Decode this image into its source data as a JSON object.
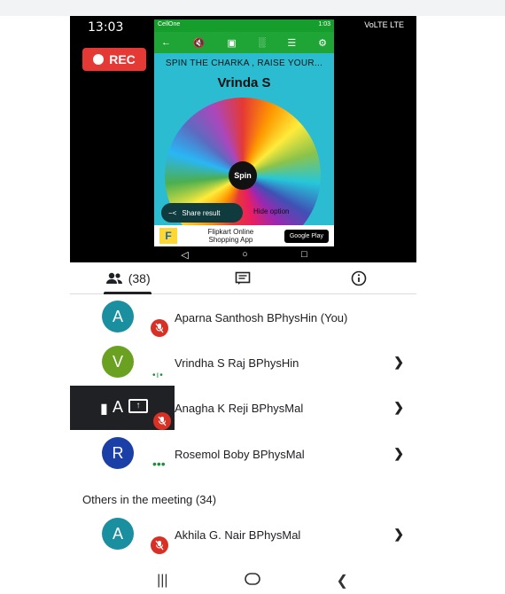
{
  "video": {
    "status_time": "13:03",
    "status_right": "VoLTE LTE",
    "rec_label": "REC",
    "phone": {
      "carrier": "CellOne",
      "clock": "1:03",
      "title": "SPIN THE CHARKA , RAISE YOUR...",
      "winner": "Vrinda S",
      "spin_label": "Spin",
      "share_label": "Share result",
      "hide_label": "Hide option",
      "ad_line1": "Flipkart Online",
      "ad_line2": "Shopping App",
      "ad_store": "Google Play",
      "ad_logo": "F"
    }
  },
  "tabs": {
    "people_count": "(38)"
  },
  "participants": [
    {
      "initial": "A",
      "name": "Aparna Santhosh BPhysHin (You)",
      "color": "#1a8fa0",
      "status": "muted"
    },
    {
      "initial": "V",
      "name": "Vrindha S Raj BPhysHin",
      "color": "#6aa121",
      "status": "speaking"
    },
    {
      "initial": "A",
      "name": "Anagha K Reji BPhysMal",
      "color": "#202124",
      "status": "muted-presenting"
    },
    {
      "initial": "R",
      "name": "Rosemol Boby BPhysMal",
      "color": "#1a3fa6",
      "status": "more"
    },
    {
      "initial": "A",
      "name": "Akhila G. Nair BPhysMal",
      "color": "#1a8fa0",
      "status": "muted"
    }
  ],
  "others_heading": "Others in the meeting (34)",
  "icons": {
    "chevron": "chevron-right-icon",
    "mute": "mic-off-icon"
  }
}
